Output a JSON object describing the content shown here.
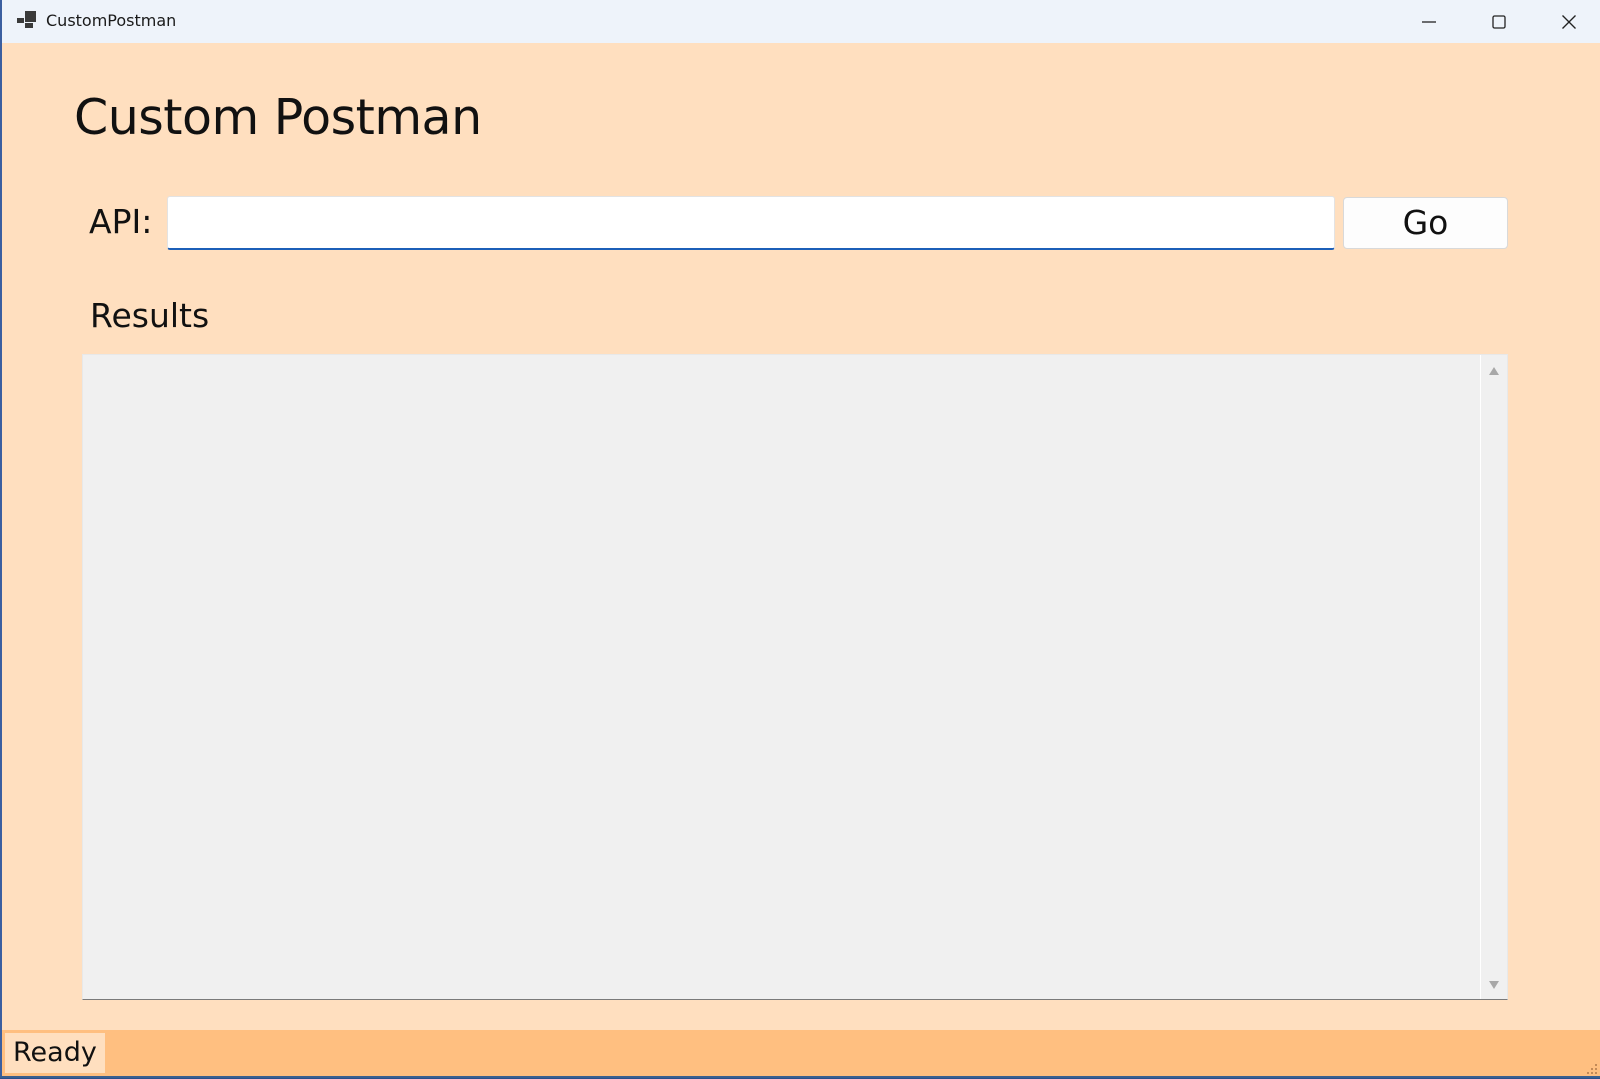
{
  "window": {
    "title": "CustomPostman"
  },
  "main": {
    "heading": "Custom Postman",
    "api_label": "API:",
    "api_value": "",
    "go_label": "Go",
    "results_label": "Results",
    "results_text": ""
  },
  "status": {
    "text": "Ready"
  },
  "colors": {
    "window_bg": "#ffdfbf",
    "statusbar_bg": "#ffbf80",
    "input_focus_underline": "#1c5fb8",
    "results_bg": "#f0f0f0"
  },
  "icons": {
    "app": "app-icon",
    "minimize": "minimize-icon",
    "maximize": "maximize-icon",
    "close": "close-icon",
    "scroll_up": "scroll-up-arrow-icon",
    "scroll_down": "scroll-down-arrow-icon",
    "resize_grip": "resize-grip-icon"
  }
}
